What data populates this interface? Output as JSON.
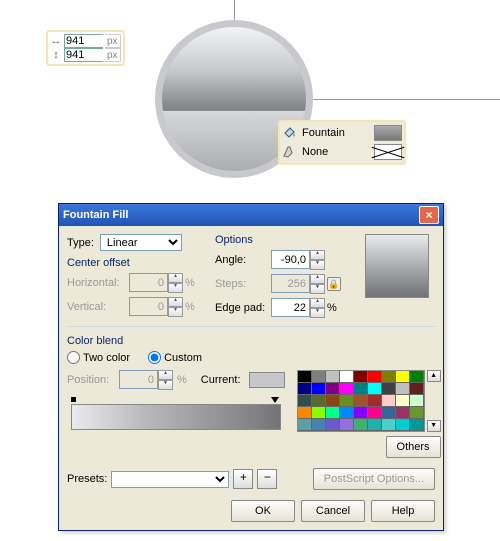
{
  "dimensions": {
    "width_value": "941",
    "height_value": "941",
    "unit": "px"
  },
  "fill_popup": {
    "fill_label": "Fountain",
    "outline_label": "None",
    "fill_swatch_color": "#808083"
  },
  "dialog": {
    "title": "Fountain Fill",
    "type_label": "Type:",
    "type_value": "Linear",
    "center_offset_label": "Center offset",
    "horizontal_label": "Horizontal:",
    "horizontal_value": "0",
    "vertical_label": "Vertical:",
    "vertical_value": "0",
    "percent": "%",
    "options_label": "Options",
    "angle_label": "Angle:",
    "angle_value": "-90,0",
    "steps_label": "Steps:",
    "steps_value": "256",
    "edgepad_label": "Edge pad:",
    "edgepad_value": "22",
    "colorblend_label": "Color blend",
    "twocolor_label": "Two color",
    "custom_label": "Custom",
    "blend_mode": "custom",
    "position_label": "Position:",
    "position_value": "0",
    "current_label": "Current:",
    "others_label": "Others",
    "presets_label": "Presets:",
    "presets_value": "",
    "postscript_label": "PostScript Options...",
    "ok_label": "OK",
    "cancel_label": "Cancel",
    "help_label": "Help"
  },
  "palette": [
    "#000000",
    "#7f7f7f",
    "#c0c0c0",
    "#ffffff",
    "#800000",
    "#ff0000",
    "#808000",
    "#ffff00",
    "#008000",
    "#000080",
    "#0000ff",
    "#800080",
    "#ff00ff",
    "#008080",
    "#00ffff",
    "#404040",
    "#bfbfbf",
    "#602020",
    "#2f4f4f",
    "#556b2f",
    "#8b4513",
    "#6b8e23",
    "#a0522d",
    "#a52a2a",
    "#ffcccc",
    "#ffffcc",
    "#ccffcc",
    "#ff8800",
    "#88ff00",
    "#00ff88",
    "#0088ff",
    "#8800ff",
    "#ff0088",
    "#336699",
    "#993366",
    "#669933",
    "#5f9ea0",
    "#4682b4",
    "#6a5acd",
    "#9370db",
    "#3cb371",
    "#20b2aa",
    "#48d1cc",
    "#00ced1",
    "#009999"
  ]
}
